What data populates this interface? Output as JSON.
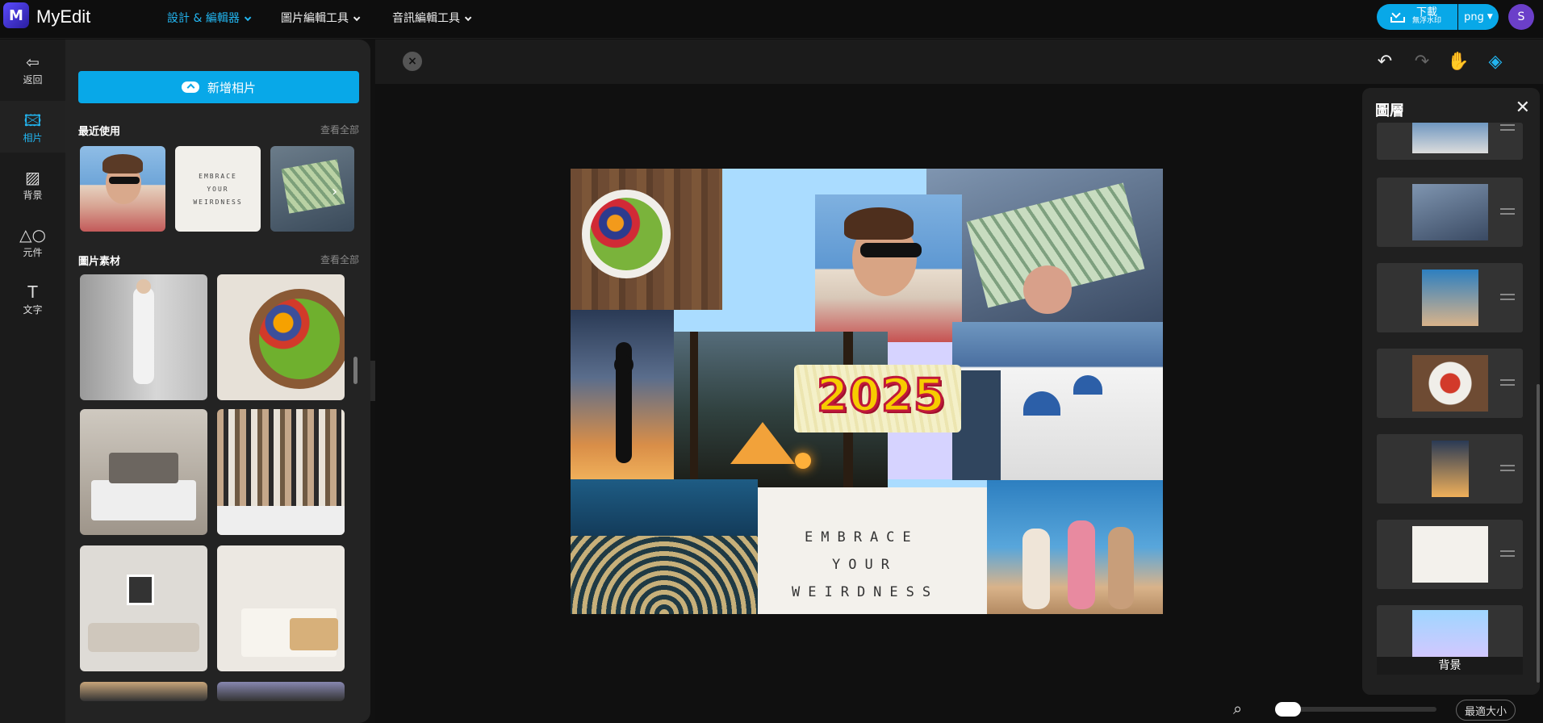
{
  "app": {
    "brand": "MyEdit"
  },
  "topnav": {
    "items": [
      {
        "label": "設計 & 編輯器"
      },
      {
        "label": "圖片編輯工具"
      },
      {
        "label": "音訊編輯工具"
      }
    ]
  },
  "download": {
    "label": "下載",
    "sub": "無浮水印",
    "format": "png"
  },
  "user": {
    "initial": "S"
  },
  "rail": {
    "items": [
      {
        "label": "返回",
        "icon": "back-arrow-icon"
      },
      {
        "label": "相片",
        "icon": "image-icon"
      },
      {
        "label": "背景",
        "icon": "background-icon"
      },
      {
        "label": "元件",
        "icon": "shapes-icon"
      },
      {
        "label": "文字",
        "icon": "text-icon"
      }
    ]
  },
  "panel": {
    "add_label": "新增相片",
    "recent_title": "最近使用",
    "recent_link": "查看全部",
    "stock_title": "圖片素材",
    "stock_link": "查看全部"
  },
  "layers": {
    "title": "圖層",
    "bg_label": "背景"
  },
  "zoom": {
    "fit_label": "最適大小"
  },
  "collage": {
    "year_text": "2025",
    "embrace_lines": [
      "EMBRACE",
      "YOUR",
      "WEIRDNESS"
    ]
  },
  "colors": {
    "accent": "#08a8e8",
    "brand": "#4a3bd6"
  }
}
